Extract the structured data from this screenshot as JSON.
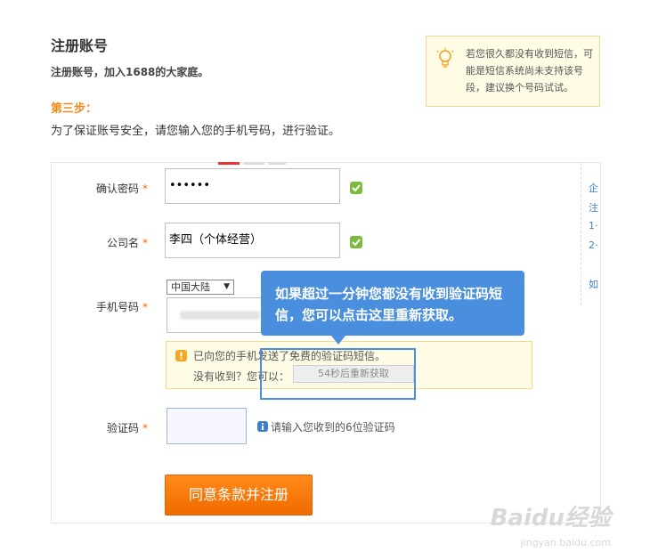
{
  "header": {
    "title": "注册账号",
    "subtitle": "注册账号，加入1688的大家庭。",
    "step_label": "第三步：",
    "step_desc": "为了保证账号安全，请您输入您的手机号码，进行验证。"
  },
  "tip": {
    "text": "若您很久都没有收到短信，可能是短信系统尚未支持该号段，建议换个号码试试。",
    "icon": "lightbulb-icon"
  },
  "form": {
    "confirm_password": {
      "label": "确认密码",
      "required_mark": "*",
      "value": "••••••"
    },
    "company": {
      "label": "公司名",
      "required_mark": "*",
      "value": "李四（个体经营）"
    },
    "phone": {
      "label": "手机号码",
      "required_mark": "*",
      "region_selected": "中国大陆"
    },
    "notice": {
      "line1": "已向您的手机发送了免费的验证码短信。",
      "line2": "没有收到？您可以：",
      "resend_button": "54秒后重新获取"
    },
    "code": {
      "label": "验证码",
      "required_mark": "*",
      "hint": "请输入您收到的6位验证码"
    },
    "submit": "同意条款并注册"
  },
  "side_panel": {
    "items": [
      "企",
      "注",
      "1·",
      "2·",
      "如"
    ]
  },
  "annotation": {
    "tooltip": "如果超过一分钟您都没有收到验证码短信，您可以点击这里重新获取。"
  },
  "watermark": {
    "brand": "Baidu经验",
    "url": "jingyan.baidu.com"
  },
  "colors": {
    "accent_orange": "#f08a1c",
    "tooltip_blue": "#4a8fdd",
    "check_green": "#7cbb3c"
  }
}
